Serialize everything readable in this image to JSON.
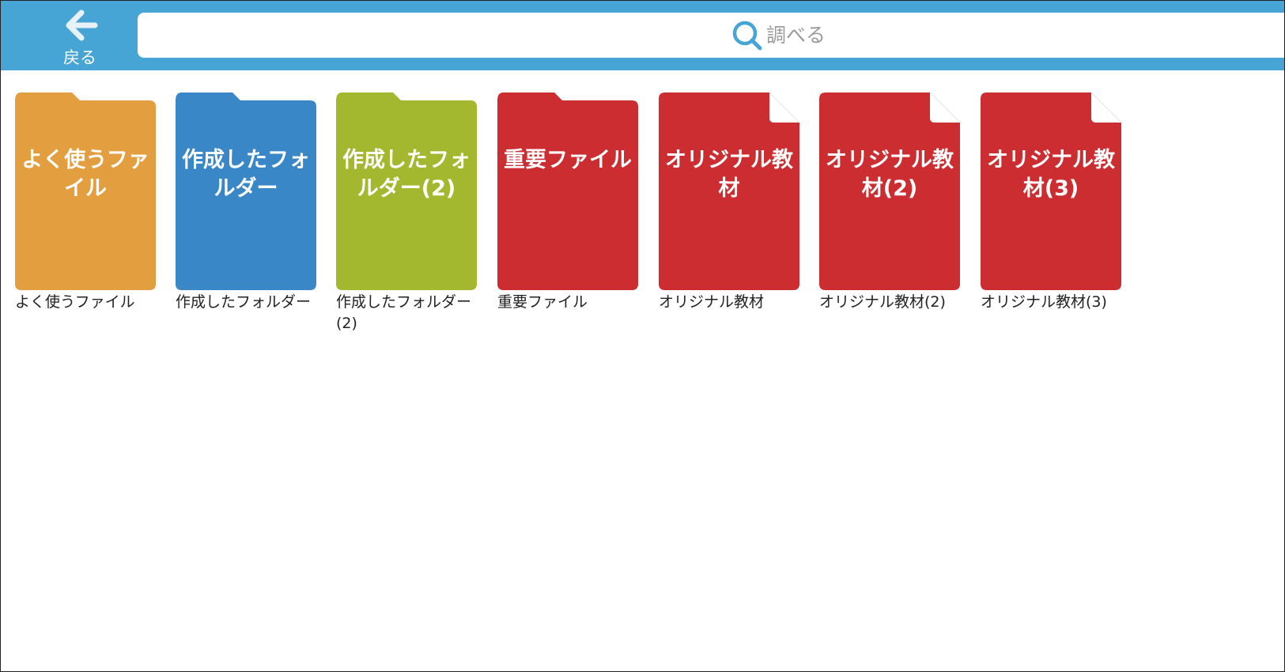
{
  "header": {
    "back_label": "戻る",
    "search_placeholder": "調べる",
    "search_value": ""
  },
  "colors": {
    "header_bg": "#46a5d5",
    "folder_orange": "#e39e3f",
    "folder_blue": "#3a87c8",
    "folder_green": "#a3b82e",
    "folder_red": "#cc2d30",
    "file_red": "#cc2d30"
  },
  "icons": {
    "back": "arrow-left-icon",
    "search": "search-icon"
  },
  "items": [
    {
      "kind": "folder",
      "color": "#e39e3f",
      "title": "よく使うファイル",
      "caption": "よく使うファイル"
    },
    {
      "kind": "folder",
      "color": "#3a87c8",
      "title": "作成したフォルダー",
      "caption": "作成したフォルダー"
    },
    {
      "kind": "folder",
      "color": "#a3b82e",
      "title": "作成したフォルダー(2)",
      "caption": "作成したフォルダー(2)"
    },
    {
      "kind": "folder",
      "color": "#cc2d30",
      "title": "重要ファイル",
      "caption": "重要ファイル"
    },
    {
      "kind": "file",
      "color": "#cc2d30",
      "title": "オリジナル教材",
      "caption": "オリジナル教材"
    },
    {
      "kind": "file",
      "color": "#cc2d30",
      "title": "オリジナル教材(2)",
      "caption": "オリジナル教材(2)"
    },
    {
      "kind": "file",
      "color": "#cc2d30",
      "title": "オリジナル教材(3)",
      "caption": "オリジナル教材(3)"
    }
  ]
}
